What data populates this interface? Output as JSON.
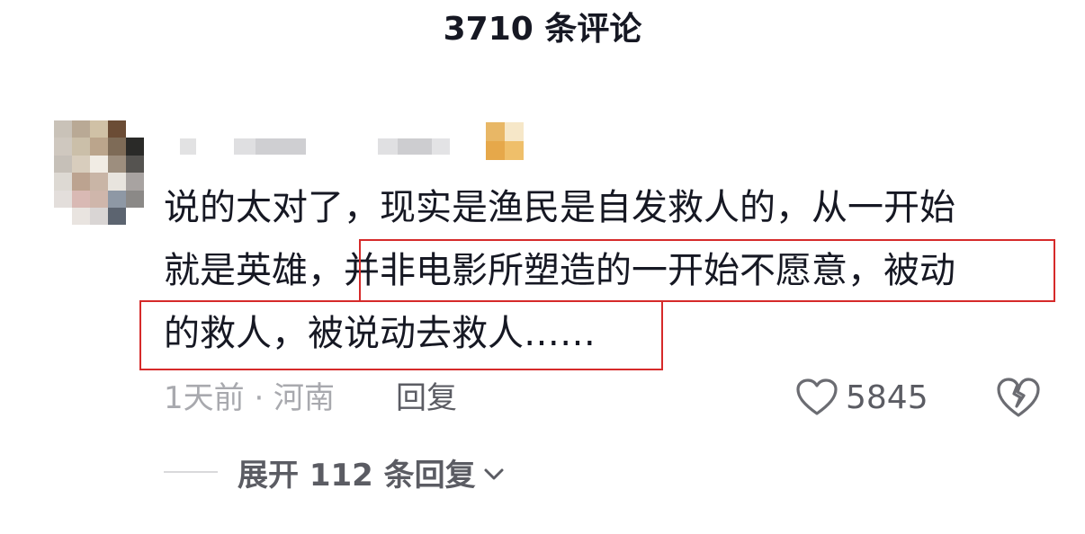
{
  "header": {
    "title": "3710 条评论"
  },
  "comment": {
    "avatar_icon": "avatar-mosaic",
    "username_masked": true,
    "text_lines": [
      "说的太对了，现实是渔民是自发救人的，从一开始",
      "就是英雄，并非电影所塑造的一开始不愿意，被动",
      "的救人，被说动去救人……"
    ],
    "meta": "1天前 · 河南",
    "reply_label": "回复",
    "like_icon": "heart-outline-icon",
    "like_count": "5845",
    "dislike_icon": "broken-heart-icon",
    "highlight_color": "#d62a2a"
  },
  "replies": {
    "expand_label": "展开 112 条回复",
    "expand_icon": "chevron-down-icon"
  }
}
